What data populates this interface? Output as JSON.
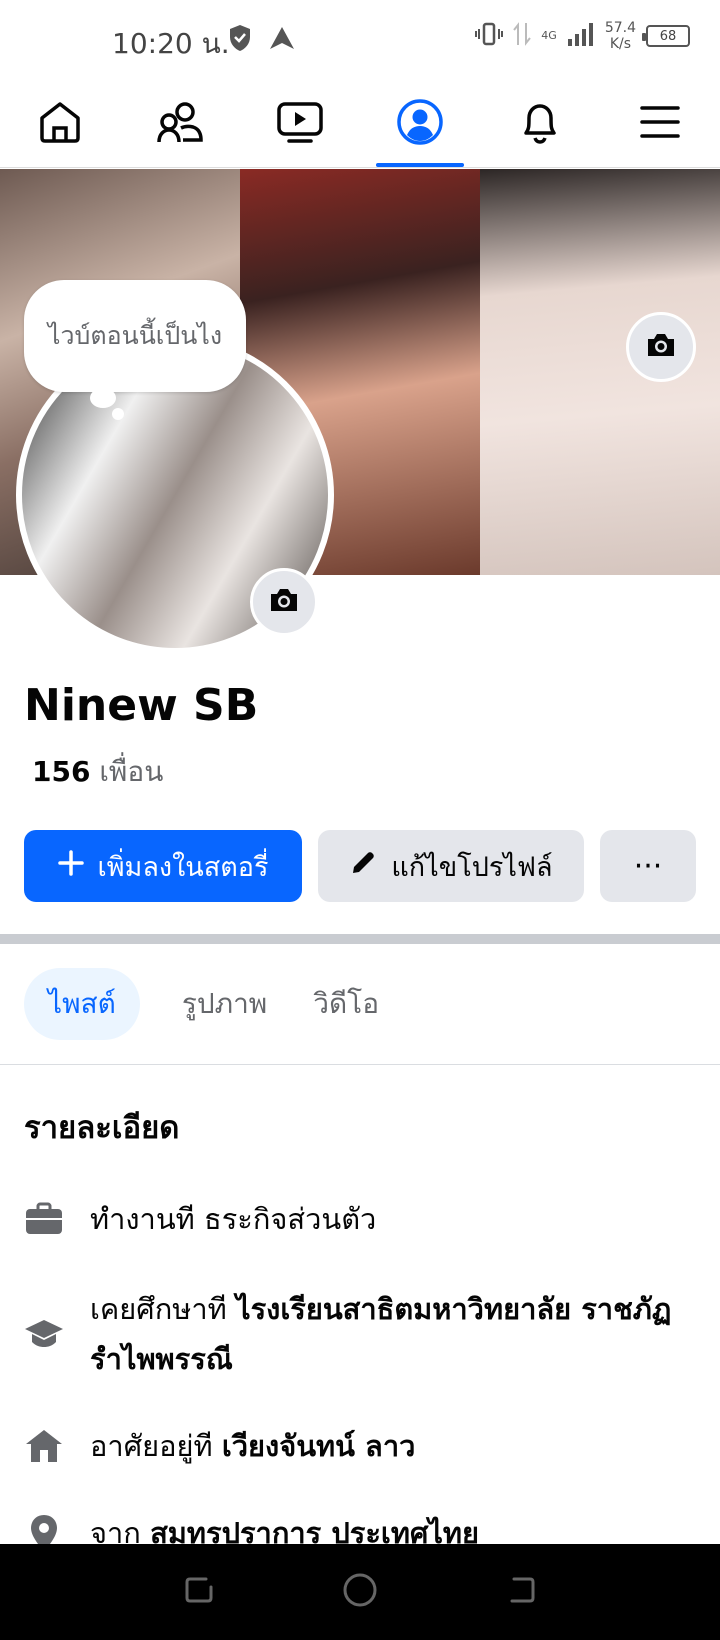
{
  "status_bar": {
    "time": "10:20 น.",
    "net_speed": "57.4",
    "net_unit": "K/s",
    "network": "4G",
    "battery": "68"
  },
  "nav": {
    "tabs": [
      "home-icon",
      "friends-icon",
      "video-icon",
      "profile-icon",
      "bell-icon",
      "menu-icon"
    ],
    "active": "profile-icon"
  },
  "profile": {
    "bubble_text": "ไวบ์ตอนนี้เป็นไง",
    "name": "Ninew SB",
    "friends_count": "156",
    "friends_label": "เพื่อน"
  },
  "actions": {
    "add_story": "เพิ่มลงในสตอรี่",
    "edit_profile": "แก้ไขโปรไฟล์",
    "more": "···"
  },
  "tabs": {
    "posts": "ไพสต์",
    "photos": "รูปภาพ",
    "videos": "วิดีโอ"
  },
  "details": {
    "title": "รายละเอียด",
    "work_prefix": "ทำงานที",
    "work_value": "ธระกิจส่วนตัว",
    "edu_prefix": "เคยศึกษาที",
    "edu_value": "ไรงเรียนสาธิตมหาวิทยาลัย ราชภัฏรำไพพรรณี",
    "lives_prefix": "อาศัยอยู่ที",
    "lives_value": "เวียงจันทน์ ลาว",
    "from_prefix": "จาก",
    "from_value": "สมุทรปราการ ประเทศไทย"
  },
  "colors": {
    "accent": "#0866ff",
    "button_grey": "#e4e6eb",
    "secondary_text": "#65676b"
  }
}
